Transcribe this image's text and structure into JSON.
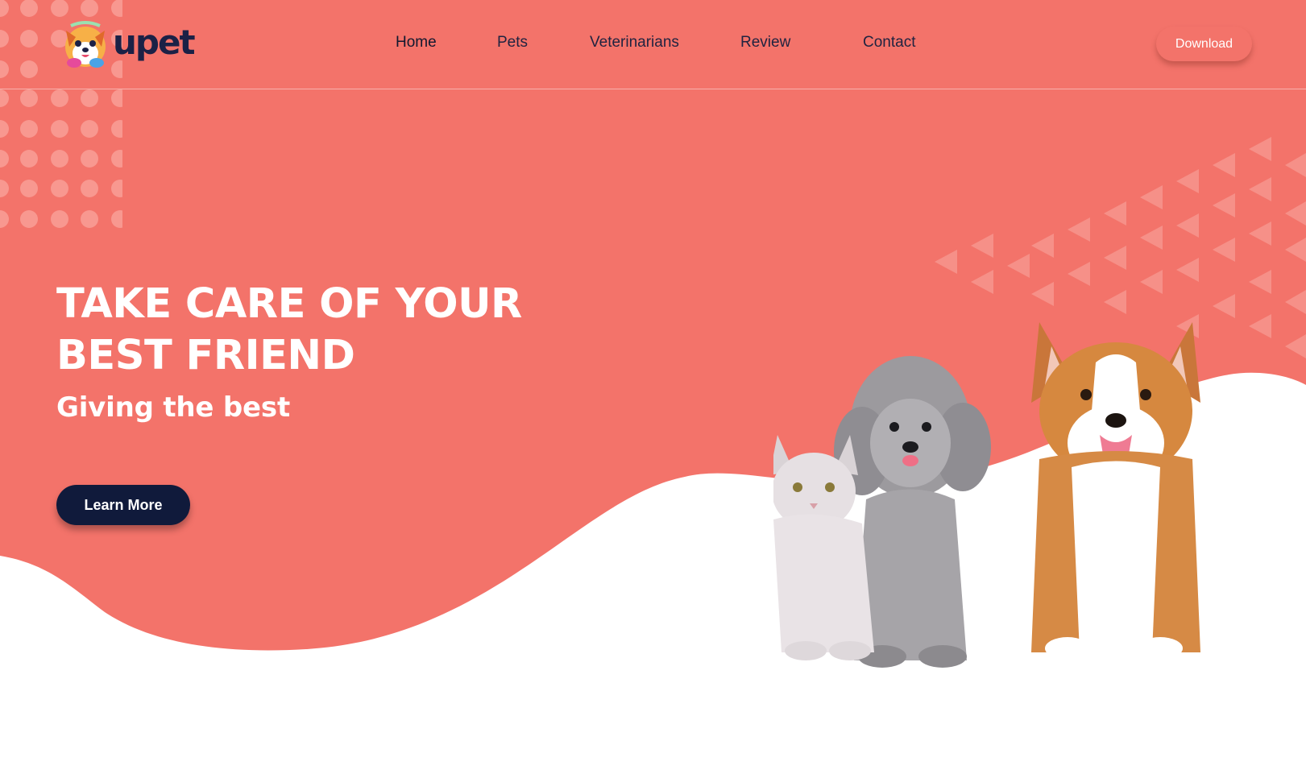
{
  "brand": {
    "name": "upet",
    "logo_icon": "corgi-mascot-icon"
  },
  "nav": {
    "items": [
      {
        "label": "Home",
        "active": true
      },
      {
        "label": "Pets",
        "active": false
      },
      {
        "label": "Veterinarians",
        "active": false
      },
      {
        "label": "Review",
        "active": false
      },
      {
        "label": "Contact",
        "active": false
      }
    ]
  },
  "header": {
    "download_label": "Download"
  },
  "hero": {
    "headline_line1": "TAKE CARE OF YOUR",
    "headline_line2": "BEST FRIEND",
    "subheadline": "Giving the best",
    "cta_label": "Learn More",
    "image_subject": "cat-poodle-corgi-photo"
  },
  "colors": {
    "hero_background": "#f3736a",
    "brand_navy": "#101a3b",
    "text_light": "#ffffff"
  }
}
